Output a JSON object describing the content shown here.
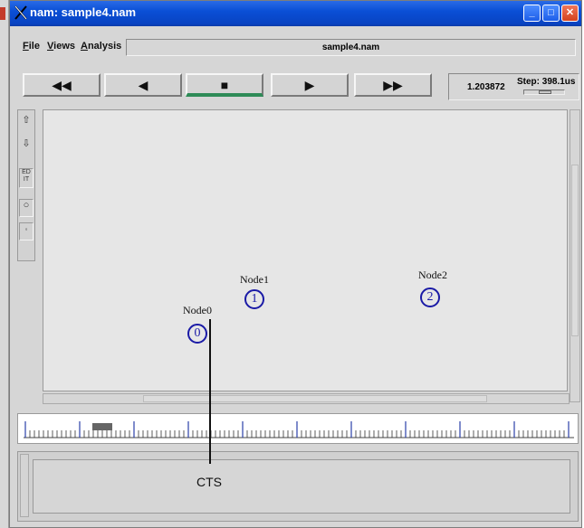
{
  "window": {
    "title": "nam: sample4.nam",
    "buttons": [
      "minimize",
      "maximize",
      "close"
    ]
  },
  "menu": {
    "items": [
      {
        "label": "File",
        "underline": "F"
      },
      {
        "label": "Views",
        "underline": "V"
      },
      {
        "label": "Analysis",
        "underline": "A"
      }
    ],
    "filename": "sample4.nam"
  },
  "controls": {
    "buttons": [
      {
        "name": "rewind-button",
        "symbol": "◀◀"
      },
      {
        "name": "back-button",
        "symbol": "◀"
      },
      {
        "name": "stop-button",
        "symbol": "■"
      },
      {
        "name": "play-button",
        "symbol": "▶"
      },
      {
        "name": "fast-forward-button",
        "symbol": "▶▶"
      }
    ],
    "time": "1.203872",
    "step_label": "Step: 398.1us"
  },
  "tools": {
    "zoom_in": "⇧",
    "zoom_out": "⇩",
    "edit": "ED IT"
  },
  "nodes": [
    {
      "label": "Node0",
      "id": "0"
    },
    {
      "label": "Node1",
      "id": "1"
    },
    {
      "label": "Node2",
      "id": "2"
    }
  ],
  "annotation": {
    "text": "CTS"
  },
  "colors": {
    "titlebar": "#0a4fd6",
    "node": "#1a1aa6",
    "timeline_ticks": "#2a3fa8",
    "active_indicator": "#2e8b57"
  }
}
